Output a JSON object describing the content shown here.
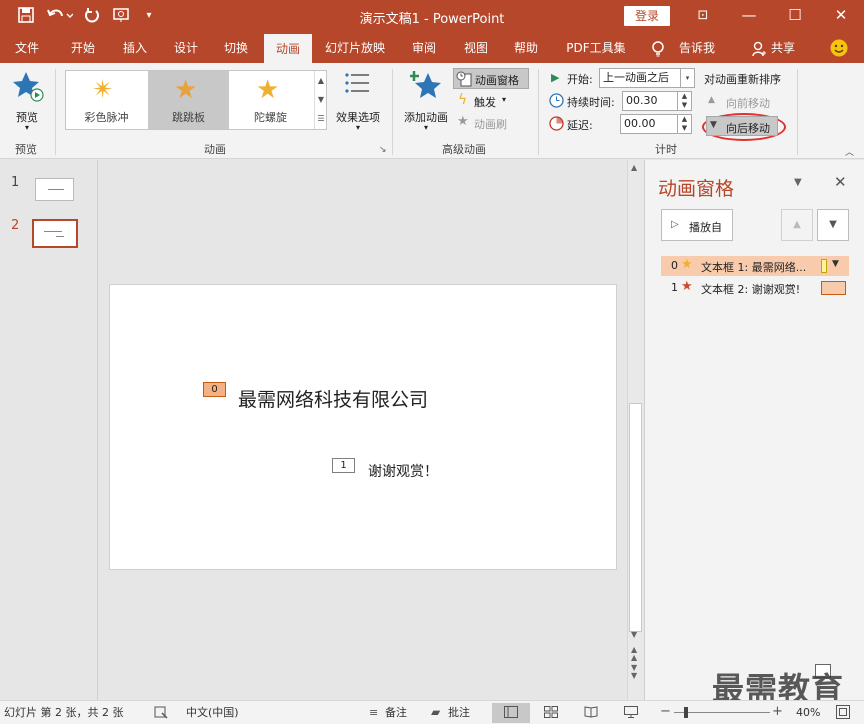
{
  "window": {
    "title": "演示文稿1  -  PowerPoint",
    "login": "登录",
    "minimize_glyph": "—",
    "maximize_glyph": "☐",
    "close_glyph": "✕",
    "restore_glyph": "⊡"
  },
  "quick_access": {
    "save_icon": "save-icon",
    "undo_icon": "undo-icon",
    "redo_icon": "redo-icon",
    "present_icon": "present-icon",
    "customize_icon": "customize-icon"
  },
  "tabs": [
    "文件",
    "开始",
    "插入",
    "设计",
    "切换",
    "动画",
    "幻灯片放映",
    "审阅",
    "视图",
    "帮助",
    "PDF工具集",
    "告诉我",
    "共享"
  ],
  "active_tab": "动画",
  "ribbon": {
    "preview": {
      "label": "预览",
      "group": "预览"
    },
    "animation_gallery": {
      "items": [
        "彩色脉冲",
        "跳跳板",
        "陀螺旋"
      ],
      "selected": "跳跳板",
      "group": "动画"
    },
    "effect_options": "效果选项",
    "advanced": {
      "add_animation": "添加动画",
      "animation_pane": "动画窗格",
      "trigger": "触发",
      "painter": "动画刷",
      "group": "高级动画"
    },
    "timing": {
      "start_label": "开始:",
      "start_value": "上一动画之后",
      "duration_label": "持续时间:",
      "duration_value": "00.30",
      "delay_label": "延迟:",
      "delay_value": "00.00",
      "group": "计时"
    },
    "reorder": {
      "title": "对动画重新排序",
      "move_earlier": "向前移动",
      "move_later": "向后移动"
    }
  },
  "slides_panel": {
    "slides": [
      {
        "number": "1",
        "selected": false
      },
      {
        "number": "2",
        "selected": true
      }
    ]
  },
  "slide": {
    "title_text": "最需网络科技有限公司",
    "title_tag": "0",
    "sub_text": "谢谢观赏！",
    "sub_tag": "1"
  },
  "animation_pane": {
    "title": "动画窗格",
    "play_from": "播放自",
    "items": [
      {
        "index": "0",
        "label": "文本框 1: 最需网络...",
        "selected": true,
        "star_color": "#f0b030"
      },
      {
        "index": "1",
        "label": "文本框 2: 谢谢观赏!",
        "selected": false,
        "star_color": "#d04a2a"
      }
    ]
  },
  "status": {
    "slide_info": "幻灯片 第 2 张，共 2 张",
    "language": "中文(中国)",
    "notes": "备注",
    "comments": "批注",
    "zoom": "40%"
  },
  "watermark": "最需教育",
  "colors": {
    "accent": "#b7472a",
    "highlight_ring": "#e03030",
    "selected_item": "#f8cbad"
  }
}
